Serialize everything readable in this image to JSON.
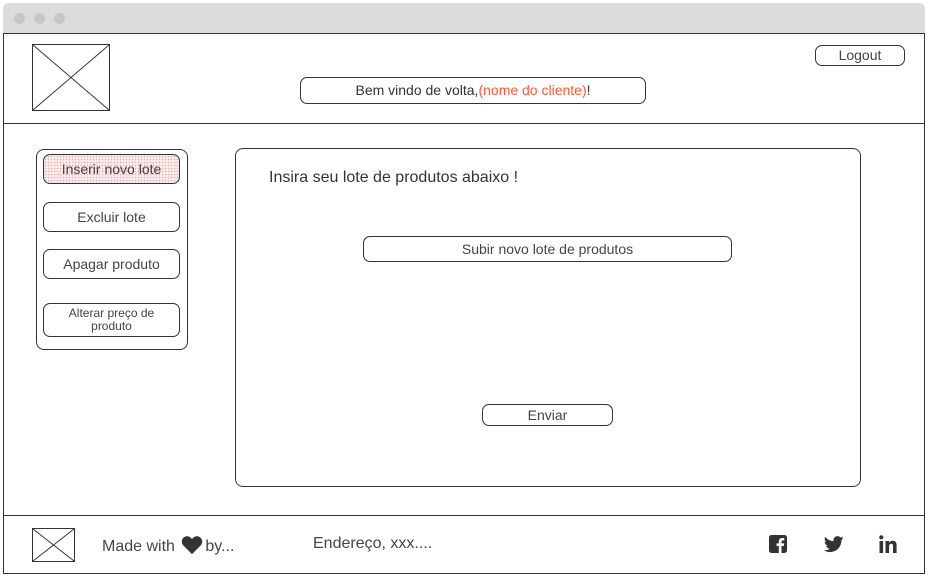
{
  "header": {
    "logout_label": "Logout",
    "welcome_prefix": "Bem vindo de volta,",
    "welcome_name": "(nome do cliente)",
    "welcome_suffix": "!"
  },
  "sidebar": {
    "items": [
      {
        "label": "Inserir novo lote",
        "active": true
      },
      {
        "label": "Excluir lote"
      },
      {
        "label": "Apagar produto"
      },
      {
        "label": "Alterar preço de produto"
      }
    ]
  },
  "main": {
    "heading": "Insira seu lote de produtos abaixo !",
    "upload_label": "Subir novo lote de produtos",
    "submit_label": "Enviar"
  },
  "footer": {
    "made_with_prefix": "Made with",
    "made_with_suffix": "by...",
    "address": "Endereço, xxx....",
    "social_icons": [
      "facebook-icon",
      "twitter-icon",
      "linkedin-icon"
    ]
  },
  "colors": {
    "accent": "#ff5a36",
    "active_fill": "#fbeeee",
    "border": "#333333"
  }
}
